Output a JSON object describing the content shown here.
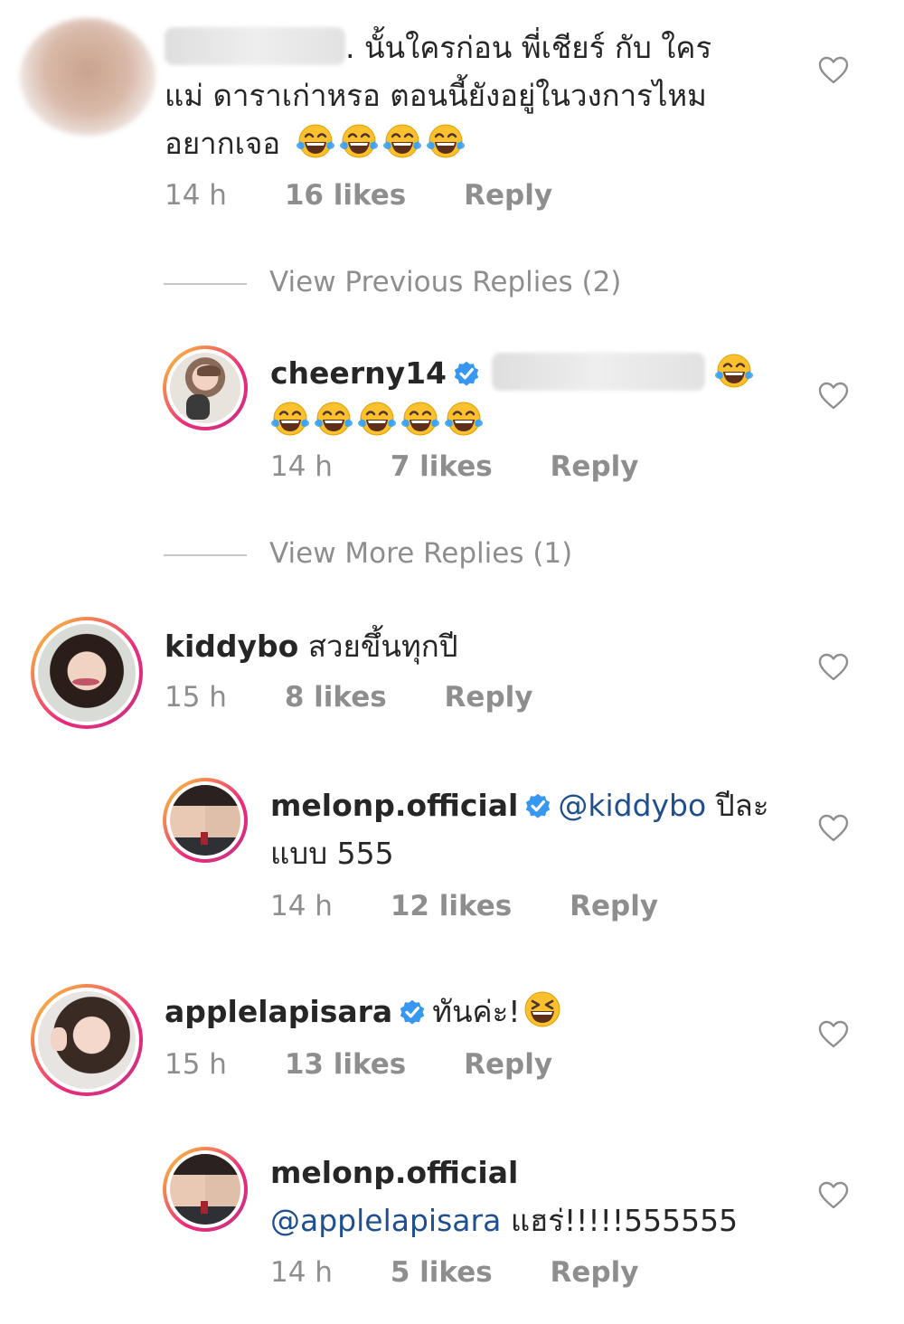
{
  "comments": [
    {
      "id": "c1",
      "username": "",
      "text_line1": ". นั้นใครก่อน พี่เชียร์ กับ ใคร",
      "text_line2": "แม่ ดาราเก่าหรอ ตอนนี้ยังอยู่ในวงการไหม",
      "text_line3": "อยากเจอ",
      "time": "14 h",
      "likes": "16 likes",
      "reply": "Reply"
    }
  ],
  "view_previous": "View Previous Replies (2)",
  "reply1": {
    "username": "cheerny14",
    "time": "14 h",
    "likes": "7 likes",
    "reply": "Reply"
  },
  "view_more": "View More Replies (1)",
  "comment2": {
    "username": "kiddybo",
    "text": "สวยขึ้นทุกปี",
    "time": "15 h",
    "likes": "8 likes",
    "reply": "Reply"
  },
  "reply2": {
    "username": "melonp.official",
    "mention": "@kiddybo",
    "text_tail": "ปีละ",
    "text_line2": "แบบ 555",
    "time": "14 h",
    "likes": "12 likes",
    "reply": "Reply"
  },
  "comment3": {
    "username": "applelapisara",
    "text": "ทันค่ะ!",
    "time": "15 h",
    "likes": "13 likes",
    "reply": "Reply"
  },
  "reply3": {
    "username": "melonp.official",
    "mention": "@applelapisara",
    "text_tail": "แฮร่!!!!!555555",
    "time": "14 h",
    "likes": "5 likes",
    "reply": "Reply"
  },
  "icons": {
    "heart": "heart-outline-icon",
    "verified": "verified-badge-icon",
    "emoji_laugh": "face-with-tears-of-joy-emoji",
    "emoji_grin": "grinning-squinting-face-emoji"
  },
  "colors": {
    "text": "#262626",
    "muted": "#8e8e8e",
    "mention": "#1f4f8f",
    "verified": "#3897f0",
    "ring_start": "#f9ce34",
    "ring_end": "#c13584"
  }
}
